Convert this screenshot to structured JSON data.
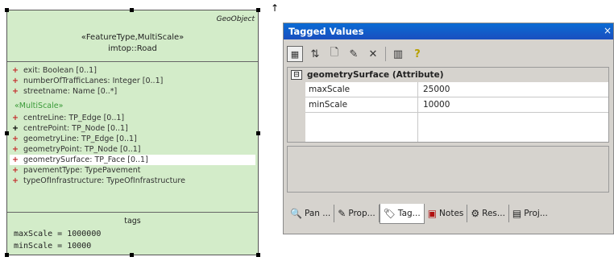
{
  "uml": {
    "corner_label": "GeoObject",
    "stereotype": "«FeatureType,MultiScale»",
    "name": "imtop::Road",
    "attributes": [
      {
        "plus": "+",
        "text": "exit:  Boolean [0..1]"
      },
      {
        "plus": "+",
        "text": "numberOfTrafficLanes:  Integer [0..1]"
      },
      {
        "plus": "+",
        "text": "streetname:  Name [0..*]"
      }
    ],
    "group_stereotype": "«MultiScale»",
    "multiscale_attributes": [
      {
        "plus": "+",
        "text": "centreLine:  TP_Edge [0..1]"
      },
      {
        "plus": "+",
        "text": "centrePoint:  TP_Node [0..1]"
      },
      {
        "plus": "+",
        "text": "geometryLine:  TP_Edge [0..1]"
      },
      {
        "plus": "+",
        "text": "geometryPoint:  TP_Node [0..1]"
      },
      {
        "plus": "+",
        "text": "geometrySurface:  TP_Face [0..1]"
      },
      {
        "plus": "+",
        "text": "pavementType:  TypePavement"
      },
      {
        "plus": "+",
        "text": "typeOfInfrastructure:  TypeOfInfrastructure"
      }
    ],
    "tags_header": "tags",
    "tags": [
      "maxScale = 1000000",
      "minScale = 10000"
    ]
  },
  "pointer": "↑",
  "tagged_values": {
    "title": "Tagged Values",
    "close": "×",
    "toolbar_icons": [
      "categorized-icon",
      "sort-icon",
      "new-tag-icon",
      "edit-icon",
      "delete-icon",
      "references-icon",
      "help-icon"
    ],
    "toolbar_glyphs": [
      "▦",
      "⇅",
      "🗋",
      "✎",
      "✕",
      "▥",
      "?"
    ],
    "group_toggle": "⊟",
    "group_label": "geometrySurface (Attribute)",
    "properties": [
      {
        "name": "maxScale",
        "value": "25000"
      },
      {
        "name": "minScale",
        "value": "10000"
      }
    ],
    "tabs": [
      {
        "icon": "🔍",
        "label": "Pan ..."
      },
      {
        "icon": "✎",
        "label": "Prop..."
      },
      {
        "icon": "🏷",
        "label": "Tag..."
      },
      {
        "icon": "▣",
        "label": "Notes"
      },
      {
        "icon": "⚙",
        "label": "Res..."
      },
      {
        "icon": "▤",
        "label": "Proj..."
      }
    ]
  }
}
